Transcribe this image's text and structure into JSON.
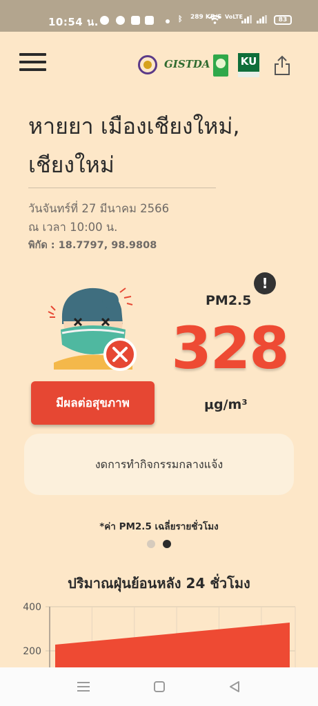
{
  "status_bar": {
    "time": "10:54 น.",
    "net_speed": "289 KB/S",
    "volte": "VoLTE",
    "battery": "83"
  },
  "header": {
    "logo_text": "GISTDA",
    "logo_ku": "KU"
  },
  "location": {
    "place_line1": "หายยา เมืองเชียงใหม่,",
    "place_line2": "เชียงใหม่",
    "date": "วันจันทร์ที่ 27 มีนาคม 2566",
    "time": "ณ เวลา 10:00 น.",
    "coordinates": "พิกัด : 18.7797, 98.9808"
  },
  "aqi": {
    "pollutant_label": "PM2.5",
    "value": "328",
    "unit": "μg/m³",
    "health_button": "มีผลต่อสุขภาพ",
    "info_symbol": "!",
    "accent_color": "#e64733",
    "advice": "งดการทำกิจกรรมกลางแจ้ง",
    "note": "*ค่า PM2.5 เฉลี่ยรายชั่วโมง",
    "carousel_pages": 2,
    "carousel_active_index": 1
  },
  "chart_section": {
    "title": "ปริมาณฝุ่นย้อนหลัง 24 ชั่วโมง"
  },
  "chart_data": {
    "type": "area",
    "title": "ปริมาณฝุ่นย้อนหลัง 24 ชั่วโมง",
    "xlabel": "",
    "ylabel": "",
    "ytick_labels": [
      "400",
      "200"
    ],
    "y_range_visible": [
      160,
      400
    ],
    "grid": true,
    "color": "#ee4a33",
    "series": [
      {
        "x": [
          0,
          1
        ],
        "values": [
          228,
          328
        ]
      }
    ]
  }
}
